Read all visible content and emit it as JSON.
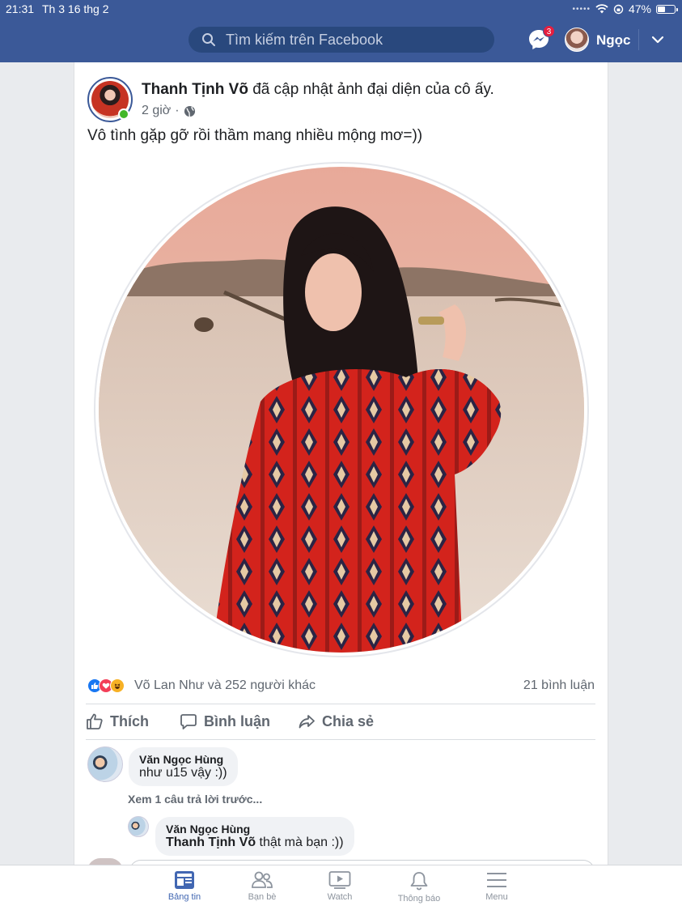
{
  "status_bar": {
    "time": "21:31",
    "date": "Th 3 16 thg 2",
    "signal": "•••••",
    "battery_text": "47%",
    "battery_level": 0.47
  },
  "header": {
    "search_placeholder": "Tìm kiếm trên Facebook",
    "messenger_badge": "3",
    "user_name": "Ngọc"
  },
  "post": {
    "author": "Thanh Tịnh Võ",
    "action": "đã cập nhật ảnh đại diện của cô ấy.",
    "time": "2 giờ",
    "dot": "·",
    "caption": "Vô tình gặp gỡ rồi thầm mang nhiều mộng mơ=))",
    "reactions_text": "Võ Lan Như và 252 người khác",
    "comments_count": "21 bình luận",
    "actions": {
      "like": "Thích",
      "comment": "Bình luận",
      "share": "Chia sẻ"
    }
  },
  "comments": [
    {
      "name": "Văn Ngọc Hùng",
      "text": "như u15 vậy :))"
    }
  ],
  "more_replies": "Xem 1 câu trả lời trước...",
  "replies": [
    {
      "name": "Văn Ngọc Hùng",
      "mention": "Thanh Tịnh Võ",
      "text": " thật mà bạn :))"
    }
  ],
  "tabs": [
    {
      "label": "Bảng tin",
      "icon": "news-feed-icon",
      "active": true
    },
    {
      "label": "Bạn bè",
      "icon": "friends-icon",
      "active": false
    },
    {
      "label": "Watch",
      "icon": "watch-icon",
      "active": false
    },
    {
      "label": "Thông báo",
      "icon": "bell-icon",
      "active": false
    },
    {
      "label": "Menu",
      "icon": "hamburger-menu-icon",
      "active": false
    }
  ],
  "colors": {
    "brand": "#3b5998",
    "online": "#42b72a",
    "badge": "#e41e3f",
    "active_tab": "#4267b2"
  }
}
